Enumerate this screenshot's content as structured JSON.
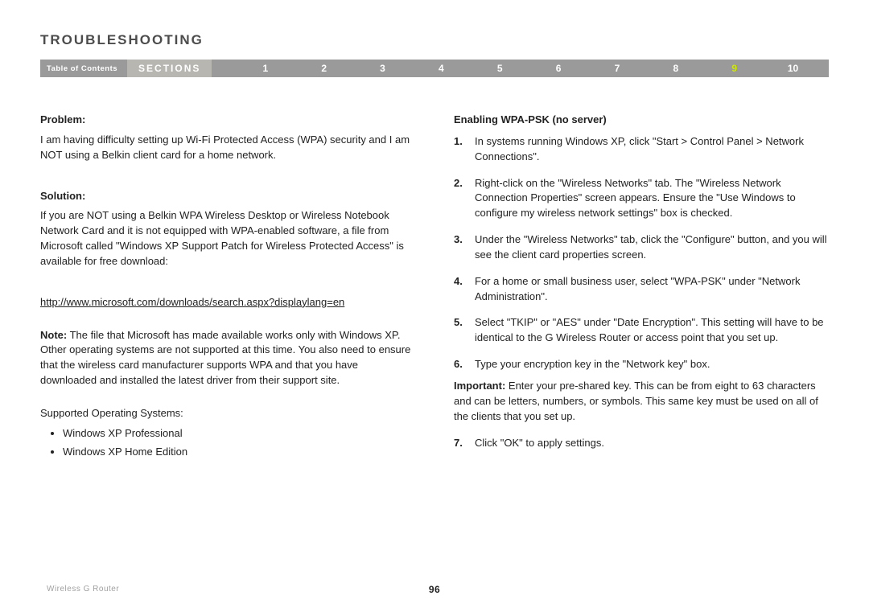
{
  "header": {
    "title": "TROUBLESHOOTING"
  },
  "nav": {
    "toc": "Table of Contents",
    "sections_label": "SECTIONS",
    "numbers": [
      "1",
      "2",
      "3",
      "4",
      "5",
      "6",
      "7",
      "8",
      "9",
      "10"
    ],
    "active_index": 8
  },
  "left": {
    "problem_h": "Problem:",
    "problem_txt": "I am having difficulty setting up Wi-Fi Protected Access (WPA) security and I am NOT using a Belkin client card for a home network.",
    "solution_h": "Solution:",
    "solution_txt": "If you are NOT using a Belkin WPA Wireless Desktop or Wireless Notebook Network Card and it is not equipped with WPA-enabled software, a file from Microsoft called \"Windows XP Support Patch for Wireless Protected Access\" is available for free download:",
    "link": "http://www.microsoft.com/downloads/search.aspx?displaylang=en",
    "note_label": "Note:",
    "note_txt": " The file that Microsoft has made available works only with Windows XP. Other operating systems are not supported at this time. You also need to ensure that the wireless card manufacturer supports WPA and that you have downloaded and installed the latest driver from their support site.",
    "supported_h": "Supported Operating Systems:",
    "bullets": [
      "Windows XP Professional",
      "Windows XP Home Edition"
    ]
  },
  "right": {
    "heading": "Enabling WPA-PSK (no server)",
    "steps": [
      "In systems running Windows XP, click \"Start > Control Panel > Network Connections\".",
      "Right-click on the \"Wireless Networks\" tab. The \"Wireless Network Connection Properties\" screen appears. Ensure the \"Use Windows to configure my wireless network settings\" box is checked.",
      "Under the \"Wireless Networks\" tab, click the \"Configure\" button, and you will see the client card properties screen.",
      "For a home or small business user, select \"WPA-PSK\" under \"Network Administration\".",
      "Select \"TKIP\" or \"AES\" under \"Date Encryption\". This setting will have to be identical to the G Wireless Router or access point that you set up.",
      "Type your encryption key in the \"Network key\" box."
    ],
    "important_label": "Important:",
    "important_txt": " Enter your pre-shared key. This can be from eight to 63 characters and can be letters, numbers, or symbols. This same key must be used on all of the clients that you set up.",
    "step7": "Click \"OK\" to apply settings."
  },
  "footer": {
    "product": "Wireless G Router",
    "page": "96"
  }
}
